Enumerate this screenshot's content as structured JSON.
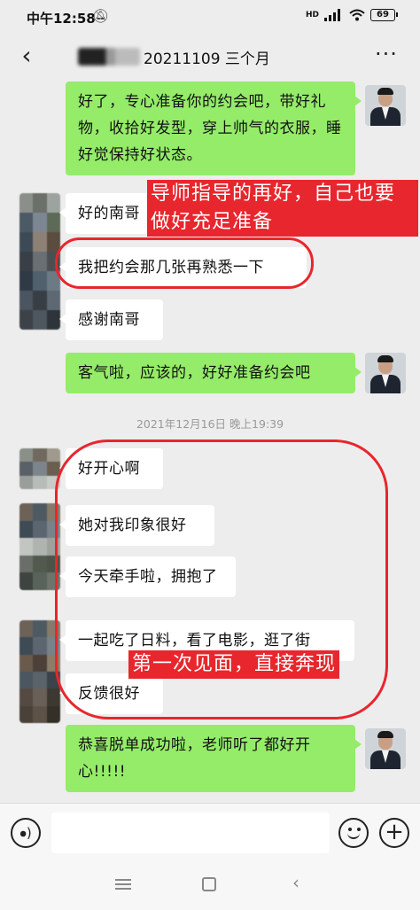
{
  "status_bar": {
    "time": "中午12:58",
    "mute_icon": "mute-icon",
    "network": "HD",
    "battery": "69"
  },
  "nav": {
    "title": "20211109 三个月",
    "back_icon": "chevron-left-icon",
    "more_icon": "more-dots-icon"
  },
  "messages": [
    {
      "from": "teacher",
      "text": "好了，专心准备你的约会吧，带好礼物，收拾好发型，穿上帅气的衣服，睡好觉保持好状态。"
    },
    {
      "from": "user",
      "text": "好的南哥"
    },
    {
      "from": "user",
      "text": "我把约会那几张再熟悉一下"
    },
    {
      "from": "user",
      "text": "感谢南哥"
    },
    {
      "from": "teacher",
      "text": "客气啦，应该的，好好准备约会吧"
    },
    {
      "from": "user",
      "text": "好开心啊"
    },
    {
      "from": "user",
      "text": "她对我印象很好"
    },
    {
      "from": "user",
      "text": "今天牵手啦，拥抱了"
    },
    {
      "from": "user",
      "text": "一起吃了日料，看了电影，逛了街"
    },
    {
      "from": "user",
      "text": "反馈很好"
    },
    {
      "from": "teacher",
      "text": "恭喜脱单成功啦，老师听了都好开心!!!!!"
    }
  ],
  "timestamp": "2021年12月16日 晚上19:39",
  "annotations": {
    "top": "导师指导的再好，自己也要做好充足准备",
    "bottom": "第一次见面，直接奔现",
    "color": "#e8262d"
  },
  "input": {
    "placeholder": "",
    "voice_icon": "voice-icon",
    "emoji_icon": "emoji-icon",
    "plus_icon": "plus-icon"
  },
  "system_nav": {
    "menu_icon": "menu-icon",
    "home_icon": "home-icon",
    "back_icon": "back-icon"
  },
  "colors": {
    "green_bubble": "#95ec69",
    "white_bubble": "#ffffff",
    "background": "#ededed"
  }
}
